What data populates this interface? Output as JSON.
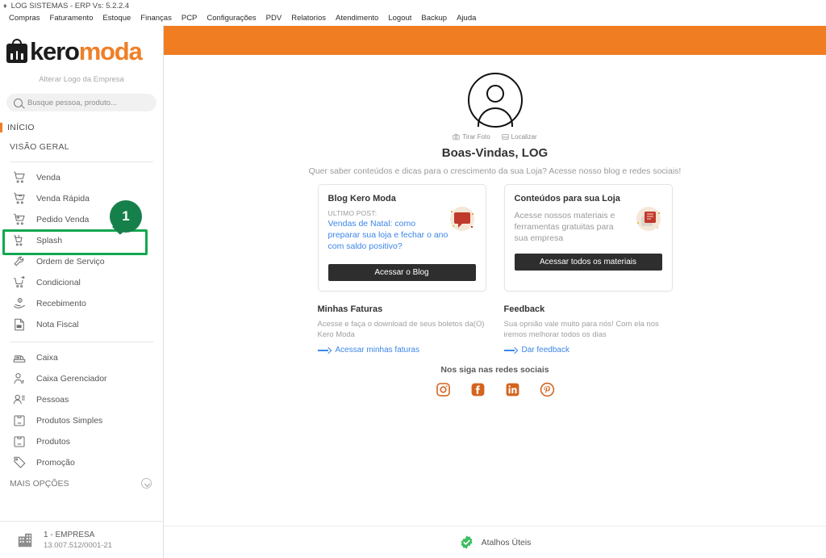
{
  "window": {
    "icon": "app-icon",
    "title": "LOG SISTEMAS - ERP Vs: 5.2.2.4"
  },
  "menubar": {
    "items": [
      {
        "label": "Compras"
      },
      {
        "label": "Faturamento"
      },
      {
        "label": "Estoque"
      },
      {
        "label": "Finanças"
      },
      {
        "label": "PCP"
      },
      {
        "label": "Configurações"
      },
      {
        "label": "PDV"
      },
      {
        "label": "Relatorios"
      },
      {
        "label": "Atendimento"
      },
      {
        "label": "Logout"
      },
      {
        "label": "Backup"
      },
      {
        "label": "Ajuda"
      }
    ]
  },
  "sidebar": {
    "logo": {
      "primary": "kero",
      "secondary": "moda"
    },
    "alterar_logo": "Alterar Logo da Empresa",
    "search": {
      "placeholder": "Busque pessoa, produto...",
      "value": ""
    },
    "inicio_label": "INÍCIO",
    "visao_geral_label": "VISÃO GERAL",
    "group1": [
      {
        "label": "Venda",
        "icon": "cart-icon"
      },
      {
        "label": "Venda Rápida",
        "icon": "cart-fast-icon"
      },
      {
        "label": "Pedido Venda",
        "icon": "cart-order-icon"
      },
      {
        "label": "Splash",
        "icon": "cart-money-icon"
      },
      {
        "label": "Ordem de Serviço",
        "icon": "wrench-icon"
      },
      {
        "label": "Condicional",
        "icon": "cart-arrow-icon"
      },
      {
        "label": "Recebimento",
        "icon": "hand-money-icon"
      },
      {
        "label": "Nota Fiscal",
        "icon": "invoice-icon"
      }
    ],
    "group2": [
      {
        "label": "Caixa",
        "icon": "register-icon"
      },
      {
        "label": "Caixa Gerenciador",
        "icon": "user-money-icon"
      },
      {
        "label": "Pessoas",
        "icon": "people-icon"
      },
      {
        "label": "Produtos Simples",
        "icon": "box-simple-icon"
      },
      {
        "label": "Produtos",
        "icon": "box-icon"
      },
      {
        "label": "Promoção",
        "icon": "tag-icon"
      }
    ],
    "mais_opcoes": "MAIS OPÇÕES",
    "company": {
      "name": "1 - EMPRESA",
      "cnpj": "13.007.512/0001-21",
      "icon": "building-icon"
    }
  },
  "annotation": {
    "marker_number": "1",
    "target_label": "Pedido Venda",
    "highlight_color": "#12a750",
    "marker_color": "#16804a"
  },
  "main": {
    "avatar_icon": "user-avatar-icon",
    "avatar_actions": [
      {
        "label": "Tirar Foto",
        "icon": "camera-icon"
      },
      {
        "label": "Localizar",
        "icon": "image-search-icon"
      }
    ],
    "welcome_title": "Boas-Vindas, LOG",
    "welcome_subtitle": "Quer saber conteúdos e dicas para o crescimento da sua Loja? Acesse nosso blog e redes sociais!",
    "cards": [
      {
        "title": "Blog Kero Moda",
        "kicker": "ULTIMO POST:",
        "post": "Vendas de Natal: como preparar sua loja e fechar o ano com saldo positivo?",
        "cta": "Acessar o Blog",
        "illustration": "speech-bubble-icon"
      },
      {
        "title": "Conteúdos para sua Loja",
        "description": "Acesse nossos materiais e ferramentas gratuitas para sua empresa",
        "cta": "Acessar todos os materiais",
        "illustration": "documents-icon"
      }
    ],
    "info": [
      {
        "title": "Minhas Faturas",
        "description": "Acesse e faça o download de seus boletos da(O) Kero Moda",
        "link": "Acessar minhas faturas"
      },
      {
        "title": "Feedback",
        "description": "Sua opnião vale muito para nós! Com ela nos iremos melhorar todos os dias",
        "link": "Dar feedback"
      }
    ],
    "social": {
      "title": "Nos siga nas redes sociais",
      "color": "#d4641e",
      "items": [
        {
          "name": "instagram-icon"
        },
        {
          "name": "facebook-icon"
        },
        {
          "name": "linkedin-icon"
        },
        {
          "name": "pinterest-icon"
        }
      ]
    },
    "footer": {
      "label": "Atalhos Úteis",
      "icon": "verified-badge-icon"
    }
  },
  "theme": {
    "accent_orange": "#f07d22",
    "logo_orange": "#ef7f27",
    "link_blue": "#3c86e8"
  }
}
